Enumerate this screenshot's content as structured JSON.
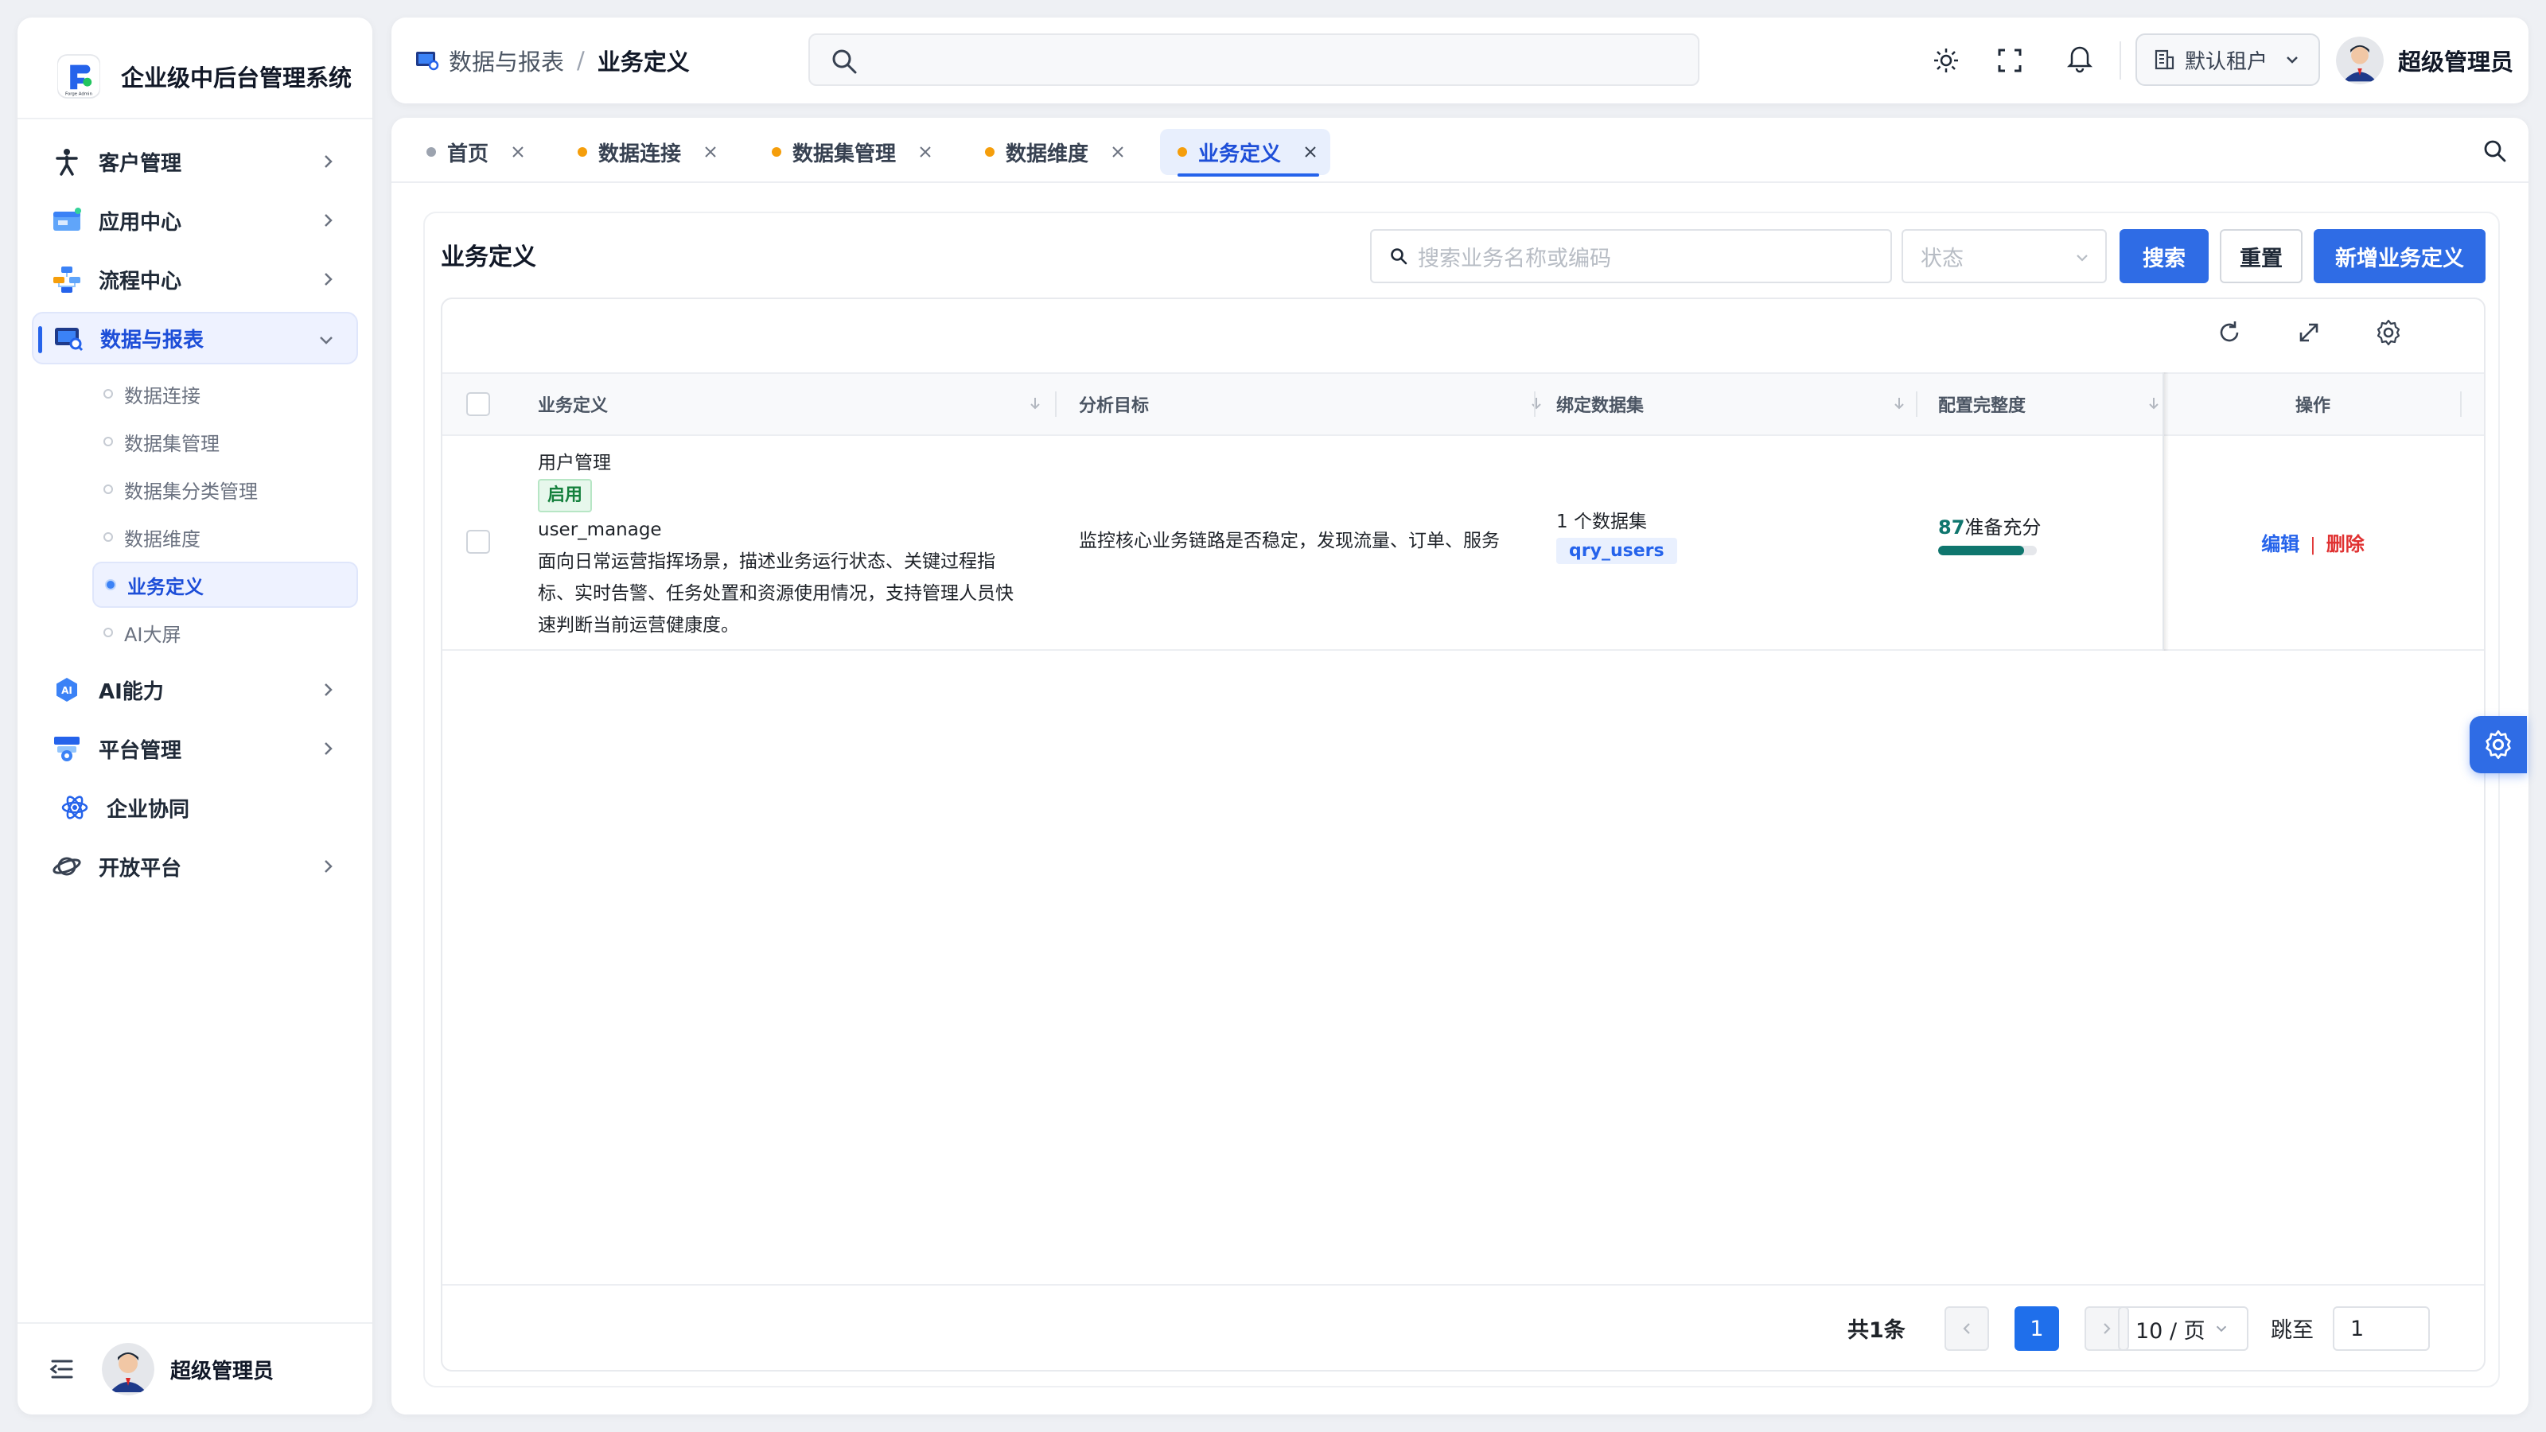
{
  "app": {
    "title": "企业级中后台管理系统",
    "logo_text": "Forge Admin"
  },
  "sidebar": {
    "items": [
      {
        "label": "客户管理",
        "icon": "person-icon"
      },
      {
        "label": "应用中心",
        "icon": "app-window-icon"
      },
      {
        "label": "流程中心",
        "icon": "flow-icon"
      },
      {
        "label": "数据与报表",
        "icon": "data-report-icon",
        "expanded": true
      },
      {
        "label": "AI能力",
        "icon": "ai-icon"
      },
      {
        "label": "平台管理",
        "icon": "platform-icon"
      },
      {
        "label": "企业协同",
        "icon": "atom-icon"
      },
      {
        "label": "开放平台",
        "icon": "planet-icon"
      }
    ],
    "sub_items": [
      "数据连接",
      "数据集管理",
      "数据集分类管理",
      "数据维度",
      "业务定义",
      "AI大屏"
    ],
    "active_sub": "业务定义",
    "footer_user": "超级管理员"
  },
  "header": {
    "breadcrumb": {
      "parent": "数据与报表",
      "separator": "/",
      "current": "业务定义"
    },
    "tenant": "默认租户",
    "user": "超级管理员"
  },
  "tabs": [
    {
      "label": "首页",
      "dot_color": "#9ca3af"
    },
    {
      "label": "数据连接",
      "dot_color": "#f59e0b"
    },
    {
      "label": "数据集管理",
      "dot_color": "#f59e0b"
    },
    {
      "label": "数据维度",
      "dot_color": "#f59e0b"
    },
    {
      "label": "业务定义",
      "dot_color": "#f59e0b",
      "active": true
    }
  ],
  "page": {
    "title": "业务定义",
    "search_placeholder": "搜索业务名称或编码",
    "status_placeholder": "状态",
    "btn_search": "搜索",
    "btn_reset": "重置",
    "btn_add": "新增业务定义"
  },
  "table": {
    "columns": [
      "业务定义",
      "分析目标",
      "绑定数据集",
      "配置完整度",
      "操作"
    ],
    "rows": [
      {
        "name": "用户管理",
        "status": "启用",
        "code": "user_manage",
        "description_lines": [
          "面向日常运营指挥场景，描述业务运行状态、关键过程指",
          "标、实时告警、任务处置和资源使用情况，支持管理人员快",
          "速判断当前运营健康度。"
        ],
        "goal": "监控核心业务链路是否稳定，发现流量、订单、服务",
        "dataset_count": "1 个数据集",
        "dataset_tag": "qry_users",
        "score": "87",
        "score_label": "准备充分",
        "score_fraction": 0.87,
        "action_edit": "编辑",
        "action_sep": "|",
        "action_delete": "删除"
      }
    ]
  },
  "pagination": {
    "total": "共1条",
    "current_page": "1",
    "page_size": "10 / 页",
    "jump_label": "跳至",
    "jump_value": "1"
  },
  "colors": {
    "primary": "#2f6ce5",
    "active_text": "#1d4ed8",
    "danger": "#e03131",
    "success": "#15803d",
    "score": "#0f766e"
  }
}
